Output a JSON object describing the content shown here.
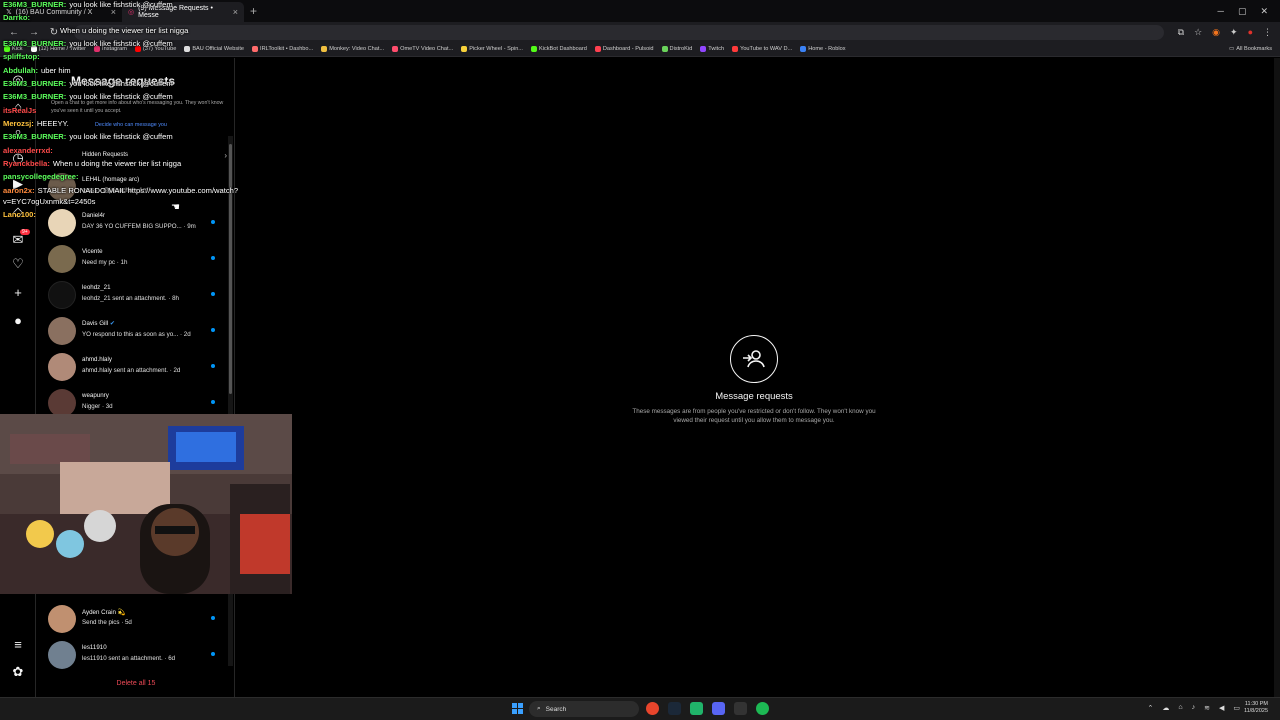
{
  "browser": {
    "tabs": [
      {
        "label": "(16) BAU Community / X",
        "active": false
      },
      {
        "label": "(9) Message Requests • Messe",
        "active": true
      }
    ],
    "bookmarks": [
      "Kick",
      "(12) Home / Twitter",
      "Instagram",
      "(37) YouTube",
      "BAU Official Website",
      "IRLToolkit • Dashbo...",
      "Monkey: Video Chat...",
      "OmeTV Video Chat...",
      "Picker Wheel - Spin...",
      "KickBot Dashboard",
      "Dashboard - Pulsoid",
      "DistroKid",
      "Twitch",
      "YouTube to WAV D...",
      "Home - Roblox"
    ],
    "all_bookmarks": "All Bookmarks"
  },
  "messages": {
    "header": "Message requests",
    "subtitle": "Open a chat to get more info about who's messaging you. They won't know you've seen it until you accept.",
    "decide_link": "Decide who can message you",
    "hidden_requests": "Hidden Requests",
    "conversations": [
      {
        "name": "LEH4L (homage arc)",
        "message": "sssss · @jainachal ·",
        "time": "1m",
        "unread": false,
        "color": "#6b5b4b"
      },
      {
        "name": "Daniel4r",
        "message": "DAY 36 YO CUFFEM BIG SUPPO... · 9m",
        "time": "",
        "unread": true,
        "color": "#e8d5b7"
      },
      {
        "name": "Vicente",
        "message": "Need my pc · 1h",
        "time": "",
        "unread": true,
        "color": "#7a6a4e"
      },
      {
        "name": "leohdz_21",
        "message": "leohdz_21 sent an attachment. · 8h",
        "time": "",
        "unread": true,
        "color": "#000000"
      },
      {
        "name": "Davis Gill",
        "verified": true,
        "message": "YO respond to this as soon as yo... · 2d",
        "time": "",
        "unread": true,
        "color": "#8a7060"
      },
      {
        "name": "ahmd.hlaly",
        "message": "ahmd.hlaly sent an attachment. · 2d",
        "time": "",
        "unread": true,
        "color": "#b08a78"
      },
      {
        "name": "weapunry",
        "message": "Nigger · 3d",
        "time": "",
        "unread": true,
        "color": "#5a3a35"
      },
      {
        "name": "Ayden Crain 💫",
        "message": "Send the pics · 5d",
        "time": "",
        "unread": true,
        "color": "#c09070"
      },
      {
        "name": "les11910",
        "message": "les11910 sent an attachment. · 6d",
        "time": "",
        "unread": true,
        "color": "#708090"
      }
    ],
    "delete_all": "Delete all 15",
    "notification_badge": "9+"
  },
  "empty_state": {
    "title": "Message requests",
    "description": "These messages are from people you've restricted or don't follow. They won't know you viewed their request until you allow them to message you."
  },
  "chat": [
    {
      "user": "E36M3_BURNER:",
      "msg": "you look like fishstick @cuffem",
      "color": "#5cff5c"
    },
    {
      "user": "Darrko:",
      "msg": "",
      "color": "#5cff5c"
    },
    {
      "user": "",
      "msg": "When u doing the viewer tier list nigga",
      "color": "#5cff5c"
    },
    {
      "user": "E36M3_BURNER:",
      "msg": "you look like fishstick @cuffem",
      "color": "#5cff5c"
    },
    {
      "user": "spliffstop:",
      "msg": "",
      "color": "#5cff5c"
    },
    {
      "user": "Abdullah:",
      "msg": "uber him",
      "color": "#5cff5c"
    },
    {
      "user": "E36M3_BURNER:",
      "msg": "you look like fishstick @cuffem",
      "color": "#5cff5c"
    },
    {
      "user": "E36M3_BURNER:",
      "msg": "you look like fishstick @cuffem",
      "color": "#5cff5c"
    },
    {
      "user": "itsRealJs",
      "msg": "",
      "color": "#ff4b4b"
    },
    {
      "user": "Merozsj:",
      "msg": "HEEEYY.",
      "color": "#ffc23d"
    },
    {
      "user": "E36M3_BURNER:",
      "msg": "you look like fishstick @cuffem",
      "color": "#5cff5c"
    },
    {
      "user": "alexanderrxd:",
      "msg": "",
      "color": "#ff4b4b"
    },
    {
      "user": "Ryanckbella:",
      "msg": "When u doing the viewer tier list nigga",
      "color": "#ff4b4b"
    },
    {
      "user": "pansycollegedegree:",
      "msg": "",
      "color": "#5cff5c"
    },
    {
      "user": "aaron2x:",
      "msg": "STABLE RONALDO MAIL https://www.youtube.com/watch?",
      "color": "#ff8a3d"
    },
    {
      "user": "",
      "msg": "v=EYC7ogUxnmk&t=2450s",
      "color": "#fff"
    },
    {
      "user": "Lanc100:",
      "msg": "",
      "color": "#ffc23d"
    }
  ],
  "taskbar": {
    "search": "Search",
    "time": "11:30 PM",
    "date": "11/8/2025"
  }
}
